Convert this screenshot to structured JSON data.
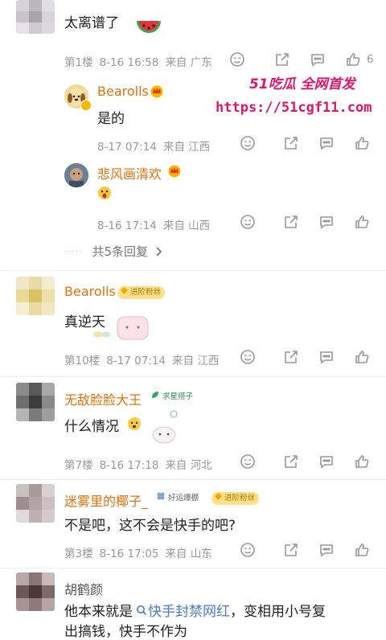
{
  "comments": [
    {
      "text": "太离谱了",
      "floor": "第1楼",
      "time": "8-16 16:58",
      "location": "来自 广东",
      "likes": "6",
      "replies": [
        {
          "name": "Bearolls",
          "text": "是的",
          "time": "8-17 07:14",
          "location": "来自 江西"
        },
        {
          "name": "悲风画清欢",
          "time": "8-16 17:14",
          "location": "来自 山西"
        }
      ],
      "more_replies": "共5条回复"
    },
    {
      "name": "Bearolls",
      "badge": "进阶粉丝",
      "text": "真逆天",
      "floor": "第10楼",
      "time": "8-17 07:14",
      "location": "来自 江西"
    },
    {
      "name": "无敌脸脸大王",
      "badge": "求星搭子",
      "text": "什么情况",
      "floor": "第7楼",
      "time": "8-16 17:18",
      "location": "来自 河北"
    },
    {
      "name": "迷雾里的椰子_",
      "badge": "好运爆棚",
      "badge2": "进阶粉丝",
      "text": "不是吧，这不会是快手的吧?",
      "floor": "第3楼",
      "time": "8-16 17:05",
      "location": "来自 山东"
    },
    {
      "name": "胡鹤颜",
      "text_line1_pre": "他本来就是",
      "topic": "快手封禁网红",
      "text_line1_post": "，变相用小号复",
      "text_line2": "出搞钱，快手不作为"
    }
  ],
  "watermark": {
    "brand": "51吃瓜 全网首发",
    "url": "https://51cgf11.com"
  },
  "colors": {
    "name": "#e8710a",
    "meta": "#9a9a9a",
    "topic": "#4a7bd1",
    "watermark": "#e0156b"
  },
  "icons": [
    "smile-icon",
    "share-icon",
    "comment-icon",
    "thumbs-up-icon",
    "chevron-right-icon",
    "search-icon"
  ]
}
